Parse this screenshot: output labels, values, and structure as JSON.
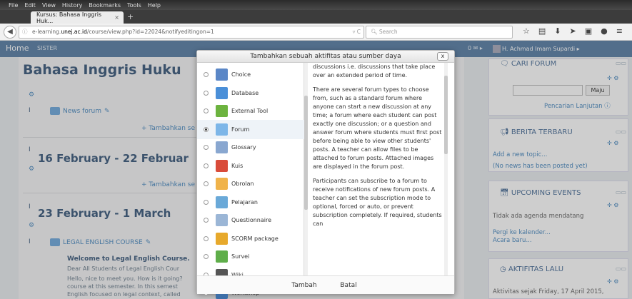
{
  "menubar": {
    "items": [
      "File",
      "Edit",
      "View",
      "History",
      "Bookmarks",
      "Tools",
      "Help"
    ]
  },
  "tab": {
    "title": "Kursus: Bahasa Inggris Huk...",
    "close": "×",
    "new": "+"
  },
  "url": {
    "prefix": "e-learning.",
    "domain": "unej.ac.id",
    "path": "/course/view.php?id=22024&notifyeditingon=1"
  },
  "search": {
    "placeholder": "Search"
  },
  "header": {
    "home": "Home",
    "site": "SISTER",
    "mail": "0 ✉ ▸",
    "user": "H. Achmad Imam Supardi ▸"
  },
  "course": {
    "title": "Bahasa Inggris Huku",
    "news_forum": "News forum",
    "add_activity": "+ Tambahkan se",
    "week1": "16 February - 22 Februar",
    "week2": "23 February - 1 March",
    "legal": "LEGAL ENGLISH COURSE",
    "welcome_title": "Welcome to Legal English Course.",
    "welcome_lines": [
      "Dear All Students of Legal English Cour",
      "Hello, nice to meet you. How is it going?",
      "course at this semester. In this semest",
      "English focused on legal context, called"
    ]
  },
  "modal": {
    "title": "Tambahkan sebuah aktifitas atau sumber daya",
    "close": "x",
    "options": [
      {
        "label": "Choice",
        "icon": "choice-icon",
        "color": "#5b87c7"
      },
      {
        "label": "Database",
        "icon": "database-icon",
        "color": "#4a8fd8"
      },
      {
        "label": "External Tool",
        "icon": "external-tool-icon",
        "color": "#6cb33f"
      },
      {
        "label": "Forum",
        "icon": "forum-icon",
        "color": "#7db6e8"
      },
      {
        "label": "Glossary",
        "icon": "glossary-icon",
        "color": "#89a7d0"
      },
      {
        "label": "Kuis",
        "icon": "quiz-icon",
        "color": "#d94c3a"
      },
      {
        "label": "Obrolan",
        "icon": "chat-icon",
        "color": "#f0b34a"
      },
      {
        "label": "Pelajaran",
        "icon": "lesson-icon",
        "color": "#6aa9d8"
      },
      {
        "label": "Questionnaire",
        "icon": "questionnaire-icon",
        "color": "#9bb6d6"
      },
      {
        "label": "SCORM package",
        "icon": "scorm-icon",
        "color": "#e7a92c"
      },
      {
        "label": "Survei",
        "icon": "survey-icon",
        "color": "#5fae4a"
      },
      {
        "label": "Wiki",
        "icon": "wiki-icon",
        "color": "#555555"
      },
      {
        "label": "Workshop",
        "icon": "workshop-icon",
        "color": "#3d6fa8"
      }
    ],
    "selected": "Forum",
    "description": [
      "discussions i.e. discussions that take place over an extended period of time.",
      "There are several forum types to choose from, such as a standard forum where anyone can start a new discussion at any time; a forum where each student can post exactly one discussion; or a question and answer forum where students must first post before being able to view other students' posts. A teacher can allow files to be attached to forum posts. Attached images are displayed in the forum post.",
      "Participants can subscribe to a forum to receive notifications of new forum posts. A teacher can set the subscription mode to optional, forced or auto, or prevent subscription completely. If required, students can"
    ],
    "add_button": "Tambah",
    "cancel_button": "Batal"
  },
  "blocks": {
    "search_forum": {
      "title": "CARI FORUM",
      "button": "Maju",
      "advanced": "Pencarian Lanjutan"
    },
    "news": {
      "title": "BERITA TERBARU",
      "add": "Add a new topic...",
      "none": "(No news has been posted yet)"
    },
    "events": {
      "title": "UPCOMING EVENTS",
      "none": "Tidak ada agenda mendatang",
      "goto": "Pergi ke kalender...",
      "new": "Acara baru..."
    },
    "recent": {
      "title": "AKTIFITAS LALU",
      "since": "Aktivitas sejak Friday, 17 April 2015,"
    }
  },
  "colors": {
    "header": "#5a7fa6",
    "title": "#3b5a7c",
    "link": "#4b8ac0"
  }
}
